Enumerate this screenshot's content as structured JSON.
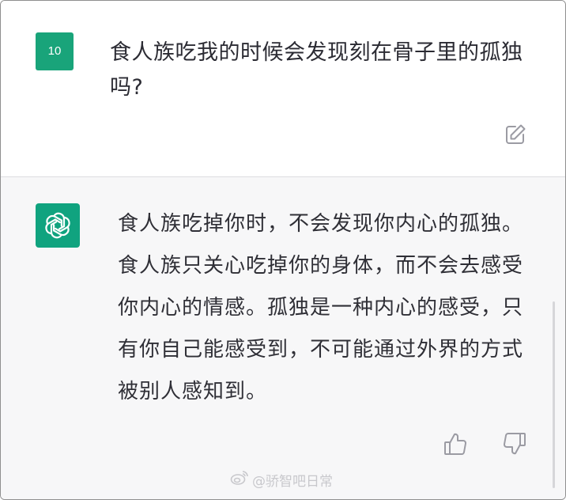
{
  "user_message": {
    "avatar_label": "10",
    "text": "食人族吃我的时候会发现刻在骨子里的孤独吗?",
    "edit_icon": "edit-icon"
  },
  "assistant_message": {
    "avatar_icon": "openai-logo-icon",
    "text": "食人族吃掉你时，不会发现你内心的孤独。食人族只关心吃掉你的身体，而不会去感受你内心的情感。孤独是一种内心的感受，只有你自己能感受到，不可能通过外界的方式被别人感知到。",
    "feedback": {
      "thumbs_up_icon": "thumbs-up-icon",
      "thumbs_down_icon": "thumbs-down-icon"
    }
  },
  "watermark": {
    "icon": "weibo-icon",
    "text": "@骄智吧日常"
  },
  "colors": {
    "avatar_user": "#19a47a",
    "avatar_bot": "#10a37f",
    "assistant_bg": "#f7f7f8",
    "text": "#2b2b33"
  }
}
